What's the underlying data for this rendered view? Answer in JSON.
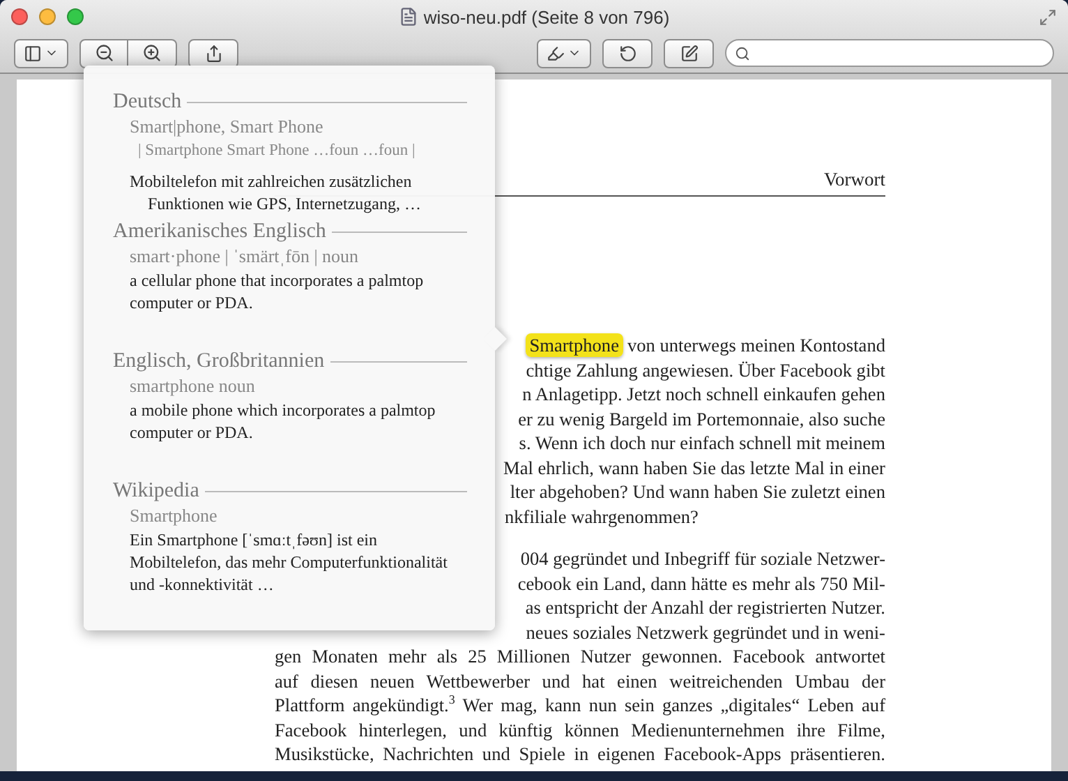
{
  "window": {
    "title": "wiso-neu.pdf (Seite 8 von 796)"
  },
  "document": {
    "running_header": "Vorwort",
    "paragraphs": [
      {
        "lines": [
          {
            "kind": "partial",
            "highlight": "Smartphone",
            "text": "von unterwegs meinen Kontostand"
          },
          {
            "kind": "partial",
            "text": "chtige Zahlung angewiesen. Über Facebook gibt"
          },
          {
            "kind": "partial",
            "text": "n Anlagetipp. Jetzt noch schnell einkaufen gehen"
          },
          {
            "kind": "partial",
            "text": "er zu wenig Bargeld im Portemonnaie, also suche"
          },
          {
            "kind": "partial",
            "text": "s. Wenn ich doch nur einfach schnell mit meinem"
          },
          {
            "kind": "partial",
            "text": "Mal ehrlich, wann haben Sie das letzte Mal in einer"
          },
          {
            "kind": "partial",
            "text": "lter abgehoben? Und wann haben Sie zuletzt einen"
          },
          {
            "kind": "partial_last",
            "text": "nkfiliale wahrgenommen?"
          }
        ]
      },
      {
        "lines": [
          {
            "kind": "partial",
            "text": "004 gegründet und Inbegriff für soziale Netzwer-"
          },
          {
            "kind": "partial",
            "text": "cebook ein Land, dann hätte es mehr als 750 Mil-"
          },
          {
            "kind": "partial",
            "text": "as entspricht der Anzahl der registrierten Nutzer."
          },
          {
            "kind": "partial",
            "text": "neues soziales Netzwerk gegründet und in weni-"
          },
          {
            "kind": "full",
            "text": "gen Monaten mehr als 25 Millionen Nutzer gewonnen. Facebook antwortet"
          },
          {
            "kind": "full",
            "text": "auf diesen neuen Wettbewerber und hat einen weitreichenden Umbau der"
          },
          {
            "kind": "full",
            "text": "Plattform angekündigt.$^{3}$ Wer mag, kann nun sein ganzes „digitales“ Leben auf"
          },
          {
            "kind": "full",
            "text": "Facebook hinterlegen, und künftig können Medienunternehmen ihre Filme,"
          },
          {
            "kind": "full",
            "text": "Musikstücke, Nachrichten und Spiele in eigenen Facebook-Apps präsentieren."
          }
        ]
      }
    ]
  },
  "dictionary_popover": {
    "sections": [
      {
        "heading": "Deutsch",
        "entries": [
          {
            "kind": "headword",
            "text": "Smart|phone, Smart Phone"
          },
          {
            "kind": "forms",
            "text": "| Smartphone  Smart Phone  …foun  …foun |"
          },
          {
            "kind": "definition",
            "text": "Mobiltelefon mit zahlreichen zusätzlichen Funktionen wie GPS, Internetzugang, …"
          }
        ]
      },
      {
        "heading": "Amerikanisches Englisch",
        "entries": [
          {
            "kind": "headword",
            "text": "smart·phone | ˈsmärtˌfōn | noun"
          },
          {
            "kind": "plain",
            "text": "a cellular phone that incorporates a palmtop computer or PDA."
          }
        ]
      },
      {
        "heading": "Englisch, Großbritannien",
        "entries": [
          {
            "kind": "headword",
            "text": "smartphone   noun"
          },
          {
            "kind": "plain",
            "text": "a mobile phone which incorporates a palmtop computer or PDA."
          }
        ]
      },
      {
        "heading": "Wikipedia",
        "entries": [
          {
            "kind": "headword",
            "text": "Smartphone"
          },
          {
            "kind": "plain",
            "text": "Ein Smartphone [ˈsmɑːtˌfəʊn] ist ein Mobiltelefon, das mehr Computerfunktionalität und -konnektivität …"
          }
        ]
      }
    ]
  }
}
